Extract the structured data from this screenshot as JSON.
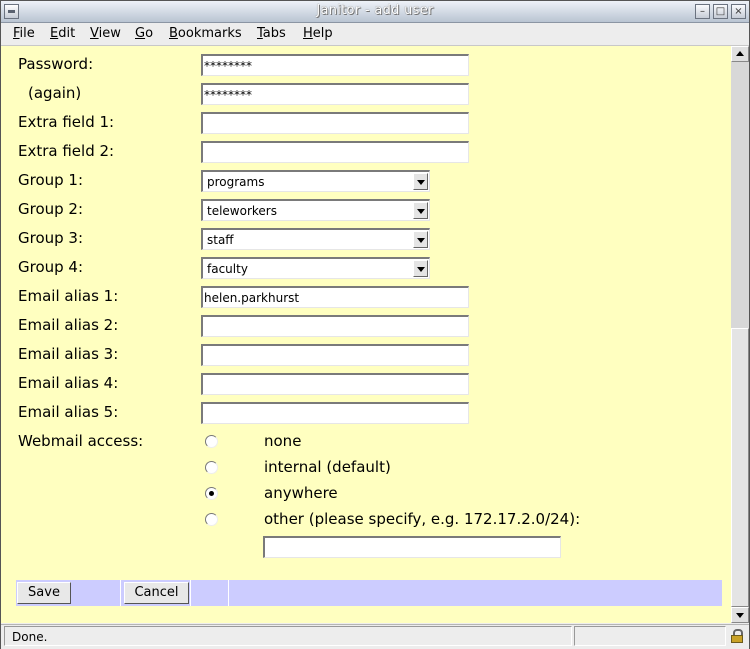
{
  "window": {
    "title": "Janitor - add user",
    "buttons": {
      "minimize": "–",
      "maximize": "□",
      "close": "×"
    }
  },
  "menubar": [
    {
      "accel": "F",
      "rest": "ile"
    },
    {
      "accel": "E",
      "rest": "dit"
    },
    {
      "accel": "V",
      "rest": "iew"
    },
    {
      "accel": "G",
      "rest": "o"
    },
    {
      "accel": "B",
      "rest": "ookmarks"
    },
    {
      "accel": "T",
      "rest": "abs"
    },
    {
      "accel": "H",
      "rest": "elp"
    }
  ],
  "form": {
    "password_label": "Password:",
    "password_value": "********",
    "again_label": "(again)",
    "again_value": "********",
    "extra1_label": "Extra field 1:",
    "extra1_value": "",
    "extra2_label": "Extra field 2:",
    "extra2_value": "",
    "groups": [
      {
        "label": "Group 1:",
        "value": "programs"
      },
      {
        "label": "Group 2:",
        "value": "teleworkers"
      },
      {
        "label": "Group 3:",
        "value": "staff"
      },
      {
        "label": "Group 4:",
        "value": "faculty"
      }
    ],
    "aliases": [
      {
        "label": "Email alias 1:",
        "value": "helen.parkhurst"
      },
      {
        "label": "Email alias 2:",
        "value": ""
      },
      {
        "label": "Email alias 3:",
        "value": ""
      },
      {
        "label": "Email alias 4:",
        "value": ""
      },
      {
        "label": "Email alias 5:",
        "value": ""
      }
    ],
    "webmail_label": "Webmail access:",
    "webmail_options": [
      {
        "label": "none",
        "selected": false
      },
      {
        "label": "internal (default)",
        "selected": false
      },
      {
        "label": "anywhere",
        "selected": true
      },
      {
        "label": "other (please specify, e.g. 172.17.2.0/24):",
        "selected": false
      }
    ],
    "other_value": "",
    "save_label": "Save",
    "cancel_label": "Cancel"
  },
  "status": {
    "text": "Done."
  },
  "colors": {
    "page_background": "#ffffc0",
    "button_bar": "#ccccff"
  },
  "icons": {
    "window": "window-menu-icon",
    "security": "lock-icon"
  }
}
